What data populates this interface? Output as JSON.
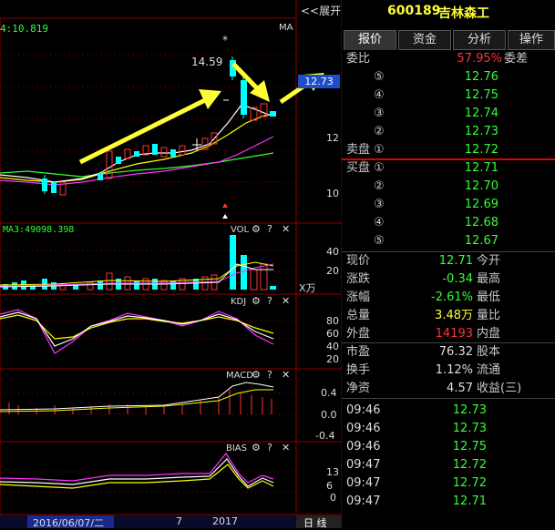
{
  "header": {
    "collapse_label": "<<展开",
    "code": "600189",
    "name": "吉林森工"
  },
  "tabs": [
    {
      "label": "报价",
      "active": true
    },
    {
      "label": "资金"
    },
    {
      "label": "分析"
    },
    {
      "label": "操作"
    }
  ],
  "order_book": {
    "weibi_label": "委比",
    "weibi_value": "57.95%",
    "weicha_label": "委差",
    "sell_label": "卖盘",
    "buy_label": "买盘",
    "sells": [
      {
        "level": "⑤",
        "price": "12.76"
      },
      {
        "level": "④",
        "price": "12.75"
      },
      {
        "level": "③",
        "price": "12.74"
      },
      {
        "level": "②",
        "price": "12.73"
      },
      {
        "level": "①",
        "price": "12.72"
      }
    ],
    "buys": [
      {
        "level": "①",
        "price": "12.71"
      },
      {
        "level": "②",
        "price": "12.70"
      },
      {
        "level": "③",
        "price": "12.69"
      },
      {
        "level": "④",
        "price": "12.68"
      },
      {
        "level": "⑤",
        "price": "12.67"
      }
    ]
  },
  "quote": {
    "current_label": "现价",
    "current": "12.71",
    "open_label": "今开",
    "change_label": "涨跌",
    "change": "-0.34",
    "high_label": "最高",
    "pct_label": "涨幅",
    "pct": "-2.61%",
    "low_label": "最低",
    "volume_label": "总量",
    "volume": "3.48万",
    "ratio_label": "量比",
    "outer_label": "外盘",
    "outer": "14193",
    "inner_label": "内盘",
    "pe_label": "市盈",
    "pe": "76.32",
    "capital_label": "股本",
    "turnover_label": "换手",
    "turnover": "1.12%",
    "float_label": "流通",
    "nav_label": "净资",
    "nav": "4.57",
    "eps_label": "收益(三)"
  },
  "ticks": [
    {
      "time": "09:46",
      "price": "12.73"
    },
    {
      "time": "09:46",
      "price": "12.73"
    },
    {
      "time": "09:46",
      "price": "12.75"
    },
    {
      "time": "09:47",
      "price": "12.72"
    },
    {
      "time": "09:47",
      "price": "12.72"
    },
    {
      "time": "09:47",
      "price": "12.71"
    }
  ],
  "chart": {
    "top_value": "4:10.819",
    "ma_label": "MA",
    "high_marker": "14.59",
    "star_marker": "*",
    "price_badge": "12.73",
    "price_axis": [
      "12",
      "10"
    ],
    "ma3_label": "MA3:49098.398",
    "vol_label": "VOL",
    "vol_axis": [
      "40",
      "20"
    ],
    "vol_unit": "X万",
    "kdj_label": "KDJ",
    "kdj_axis": [
      "80",
      "60",
      "40",
      "20",
      "0"
    ],
    "macd_label": "MACD",
    "macd_axis": [
      "0.4",
      "0.0",
      "-0.4"
    ],
    "bias_label": "BIAS",
    "bias_axis": [
      "13",
      "6",
      "0"
    ],
    "gear_icon": "⚙",
    "question_icon": "?",
    "close_icon": "✕",
    "date_label": "2016/06/07/二",
    "x_ticks": [
      "7",
      "2017"
    ],
    "period_label": "日 线"
  },
  "colors": {
    "up": "#ff3333",
    "down": "#00ffff",
    "ma_white": "#ffffff",
    "ma_yellow": "#ffff00",
    "ma_magenta": "#ff33ff",
    "ma_green": "#33ff33",
    "arrow": "#ffff33"
  }
}
